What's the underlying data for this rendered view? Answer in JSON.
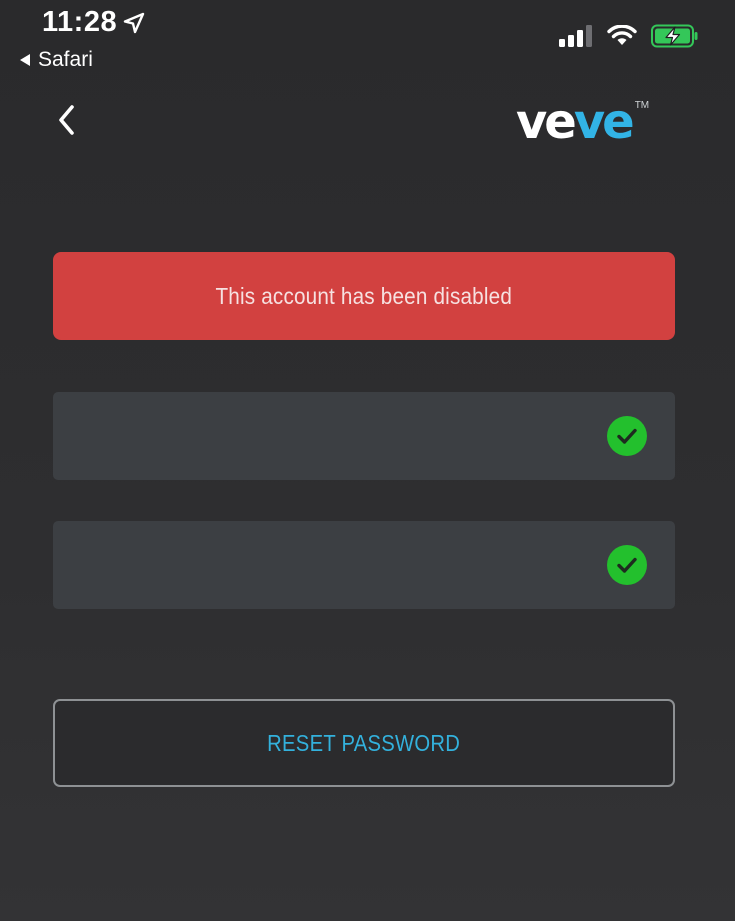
{
  "status_bar": {
    "time": "11:28",
    "back_app_label": "Safari",
    "location_icon": "location-arrow-icon",
    "signal_icon": "cellular-signal-icon",
    "wifi_icon": "wifi-icon",
    "battery_icon": "battery-charging-icon"
  },
  "nav": {
    "back_icon": "chevron-left-icon",
    "logo_part1": "ve",
    "logo_part2": "ve",
    "logo_tm": "TM"
  },
  "alert": {
    "message": "This account has been disabled",
    "color": "#d24140"
  },
  "fields": [
    {
      "value": "",
      "valid": true
    },
    {
      "value": "",
      "valid": true
    }
  ],
  "check_color": "#23c02d",
  "reset_button": {
    "label": "RESET PASSWORD",
    "color": "#33b1dc"
  }
}
